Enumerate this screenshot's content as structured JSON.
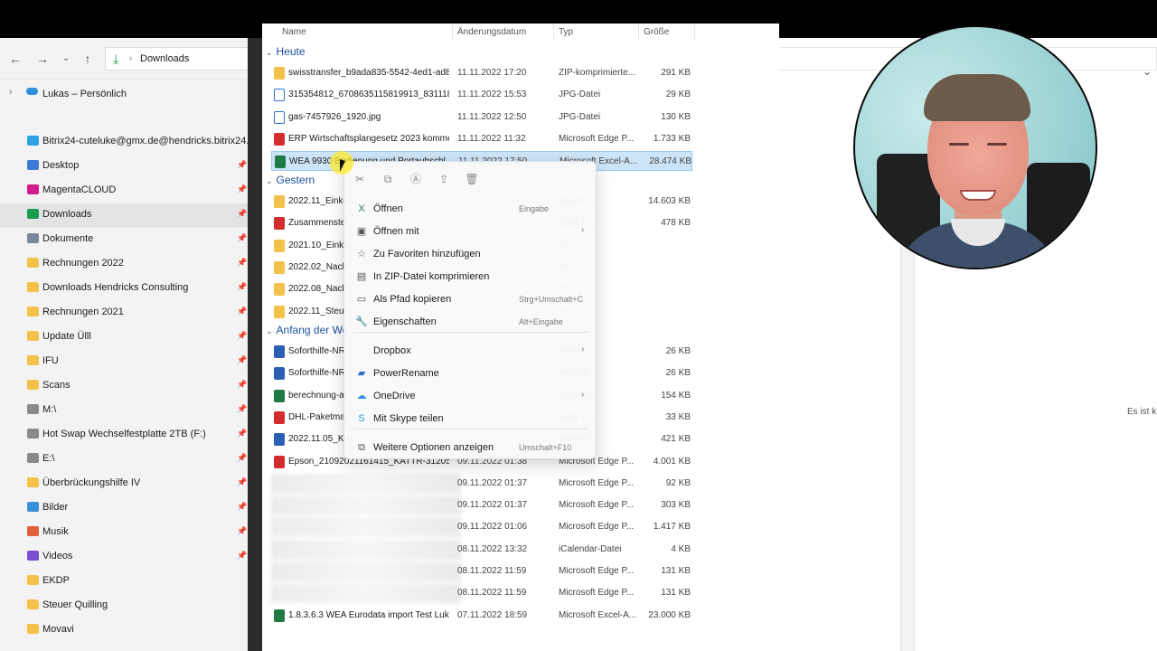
{
  "address": {
    "back_icon": "arrow-left-icon",
    "forward_icon": "arrow-right-icon",
    "recent_icon": "chevron-down-icon",
    "up_icon": "arrow-up-icon",
    "path_icon_glyph": "⤓",
    "path_chevron": "›",
    "path_label": "Downloads"
  },
  "sidebar": {
    "onedrive": {
      "label": "Lukas – Persönlich",
      "expander": "›"
    },
    "items": [
      {
        "label": "Bitrix24-cuteluke@gmx.de@hendricks.bitrix24.d",
        "icon": "bitrix",
        "pinned": false
      },
      {
        "label": "Desktop",
        "icon": "desktop",
        "pinned": true
      },
      {
        "label": "MagentaCLOUD",
        "icon": "magenta",
        "pinned": true
      },
      {
        "label": "Downloads",
        "icon": "download",
        "pinned": true,
        "selected": true
      },
      {
        "label": "Dokumente",
        "icon": "document",
        "pinned": true
      },
      {
        "label": "Rechnungen 2022",
        "icon": "folder",
        "pinned": true
      },
      {
        "label": "Downloads Hendricks Consulting",
        "icon": "folder",
        "pinned": true
      },
      {
        "label": "Rechnungen 2021",
        "icon": "folder",
        "pinned": true
      },
      {
        "label": "Update Ülll",
        "icon": "folder",
        "pinned": true
      },
      {
        "label": "IFU",
        "icon": "folder",
        "pinned": true
      },
      {
        "label": "Scans",
        "icon": "folder",
        "pinned": true
      },
      {
        "label": "M:\\",
        "icon": "drive",
        "pinned": true
      },
      {
        "label": "Hot Swap Wechselfestplatte 2TB (F:)",
        "icon": "drive",
        "pinned": true
      },
      {
        "label": "E:\\",
        "icon": "drive",
        "pinned": true
      },
      {
        "label": "Überbrückungshilfe IV",
        "icon": "folder",
        "pinned": true
      },
      {
        "label": "Bilder",
        "icon": "pictures",
        "pinned": true
      },
      {
        "label": "Musik",
        "icon": "music",
        "pinned": true
      },
      {
        "label": "Videos",
        "icon": "videos",
        "pinned": true
      },
      {
        "label": "EKDP",
        "icon": "folder",
        "pinned": false
      },
      {
        "label": "Steuer Quilling",
        "icon": "folder",
        "pinned": false
      },
      {
        "label": "Movavi",
        "icon": "folder",
        "pinned": false
      }
    ],
    "pin_glyph": "📌"
  },
  "file_list": {
    "columns": [
      "Name",
      "Änderungsdatum",
      "Typ",
      "Größe"
    ],
    "group_chevron": "⌄",
    "groups": [
      {
        "label": "Heute",
        "rows": [
          {
            "name": "swisstransfer_b9ada835-5542-4ed1-ad81-...",
            "date": "11.11.2022 17:20",
            "type": "ZIP-komprimierte...",
            "size": "291 KB",
            "icon": "zip"
          },
          {
            "name": "315354812_6708635115819913_831118504...",
            "date": "11.11.2022 15:53",
            "type": "JPG-Datei",
            "size": "29 KB",
            "icon": "jpg"
          },
          {
            "name": "gas-7457926_1920.jpg",
            "date": "11.11.2022 12:50",
            "type": "JPG-Datei",
            "size": "130 KB",
            "icon": "jpg"
          },
          {
            "name": "ERP Wirtschaftsplangesetz 2023 kommen...",
            "date": "11.11.2022 11:32",
            "type": "Microsoft Edge P...",
            "size": "1.733 KB",
            "icon": "pdf"
          },
          {
            "name": "WEA 9930 Bedienung und Portaubschl...",
            "date": "11.11.2022 17:50",
            "type": "Microsoft Excel-A...",
            "size": "28.474 KB",
            "icon": "xls",
            "selected": true
          }
        ]
      },
      {
        "label": "Gestern",
        "rows": [
          {
            "name": "2022.11_Einkor",
            "date": "",
            "type": "rimierte...",
            "size": "14.603 KB",
            "icon": "zip"
          },
          {
            "name": "Zusammenstel",
            "date": "",
            "type": "Edge P...",
            "size": "478 KB",
            "icon": "pdf"
          },
          {
            "name": "2021.10_Einkor",
            "date": "",
            "type": "er",
            "size": "",
            "icon": "zip"
          },
          {
            "name": "2022.02_Nachf",
            "date": "",
            "type": "er",
            "size": "",
            "icon": "zip"
          },
          {
            "name": "2022.08_Nachf",
            "date": "",
            "type": "er",
            "size": "",
            "icon": "zip"
          },
          {
            "name": "2022.11_Steuer",
            "date": "",
            "type": "er",
            "size": "",
            "icon": "zip"
          }
        ]
      },
      {
        "label": "Anfang der Wo",
        "rows": [
          {
            "name": "Soforthilfe-NR",
            "date": "",
            "type": "Word 9...",
            "size": "26 KB",
            "icon": "doc"
          },
          {
            "name": "Soforthilfe-NR",
            "date": "",
            "type": "Word 9...",
            "size": "26 KB",
            "icon": "doc"
          },
          {
            "name": "berechnung-ar",
            "date": "",
            "type": "Excel-A...",
            "size": "154 KB",
            "icon": "xls"
          },
          {
            "name": "DHL-Paketmar",
            "date": "",
            "type": "Edge P...",
            "size": "33 KB",
            "icon": "pdf"
          },
          {
            "name": "2022.11.05_Kur",
            "date": "",
            "type": "Word-D...",
            "size": "421 KB",
            "icon": "doc"
          },
          {
            "name": "Epson_21092021161415_KATTR-312059.pdf",
            "date": "09.11.2022 01:38",
            "type": "Microsoft Edge P...",
            "size": "4.001 KB",
            "icon": "pdf"
          },
          {
            "name": "",
            "date": "09.11.2022 01:37",
            "type": "Microsoft Edge P...",
            "size": "92 KB",
            "icon": "pdf",
            "blurred": true
          },
          {
            "name": "",
            "date": "09.11.2022 01:37",
            "type": "Microsoft Edge P...",
            "size": "303 KB",
            "icon": "pdf",
            "blurred": true
          },
          {
            "name": "",
            "date": "09.11.2022 01:06",
            "type": "Microsoft Edge P...",
            "size": "1.417 KB",
            "icon": "pdf",
            "blurred": true
          },
          {
            "name": "",
            "date": "08.11.2022 13:32",
            "type": "iCalendar-Datei",
            "size": "4 KB",
            "icon": "ics",
            "blurred": true
          },
          {
            "name": "",
            "date": "08.11.2022 11:59",
            "type": "Microsoft Edge P...",
            "size": "131 KB",
            "icon": "pdf",
            "blurred": true
          },
          {
            "name": "",
            "date": "08.11.2022 11:59",
            "type": "Microsoft Edge P...",
            "size": "131 KB",
            "icon": "pdf",
            "blurred": true
          },
          {
            "name": "1.8.3.6.3 WEA Eurodata import Test Lukas...",
            "date": "07.11.2022 18:59",
            "type": "Microsoft Excel-A...",
            "size": "23.000 KB",
            "icon": "xls"
          }
        ]
      }
    ]
  },
  "context_menu": {
    "quick_actions": [
      {
        "icon": "cut-icon",
        "glyph": "✂"
      },
      {
        "icon": "copy-icon",
        "glyph": "⧉"
      },
      {
        "icon": "rename-icon",
        "glyph": "Ⓐ"
      },
      {
        "icon": "share-icon",
        "glyph": "⇪"
      },
      {
        "icon": "delete-icon",
        "glyph": "🗑"
      }
    ],
    "items": [
      {
        "label": "Öffnen",
        "shortcut": "Eingabe",
        "icon": "excel-icon",
        "glyph": "X",
        "color": "#1f7a43",
        "arrow": false
      },
      {
        "label": "Öffnen mit",
        "shortcut": "",
        "icon": "open-with-icon",
        "glyph": "▣",
        "color": "#555555",
        "arrow": true
      },
      {
        "label": "Zu Favoriten hinzufügen",
        "shortcut": "",
        "icon": "star-icon",
        "glyph": "☆",
        "color": "#555555",
        "arrow": false
      },
      {
        "label": "In ZIP-Datei komprimieren",
        "shortcut": "",
        "icon": "zip-icon",
        "glyph": "▤",
        "color": "#555555",
        "arrow": false
      },
      {
        "label": "Als Pfad kopieren",
        "shortcut": "Strg+Umschalt+C",
        "icon": "copy-path-icon",
        "glyph": "▭",
        "color": "#555555",
        "arrow": false
      },
      {
        "label": "Eigenschaften",
        "shortcut": "Alt+Eingabe",
        "icon": "wrench-icon",
        "glyph": "🔧",
        "color": "#555555",
        "arrow": false
      },
      {
        "label": "Dropbox",
        "shortcut": "",
        "icon": "dropbox-icon",
        "glyph": "",
        "color": "#555555",
        "arrow": true
      },
      {
        "label": "PowerRename",
        "shortcut": "",
        "icon": "powerrename-icon",
        "glyph": "▰",
        "color": "#2b6cd6",
        "arrow": false
      },
      {
        "label": "OneDrive",
        "shortcut": "",
        "icon": "onedrive-icon",
        "glyph": "☁",
        "color": "#2f8fe0",
        "arrow": true
      },
      {
        "label": "Mit Skype teilen",
        "shortcut": "",
        "icon": "skype-icon",
        "glyph": "S",
        "color": "#1a9ee0",
        "arrow": false
      },
      {
        "label": "Weitere Optionen anzeigen",
        "shortcut": "Umschalt+F10",
        "icon": "more-options-icon",
        "glyph": "⧉",
        "color": "#555555",
        "arrow": false
      }
    ],
    "arrow_glyph": "›"
  },
  "preview": {
    "text": "Es ist k"
  },
  "right_pane": {
    "chevron": "⌄"
  },
  "colors": {
    "accent": "#1f4fa0",
    "selection": "#cce4f7",
    "cursor_highlight": "#ffeb28"
  }
}
